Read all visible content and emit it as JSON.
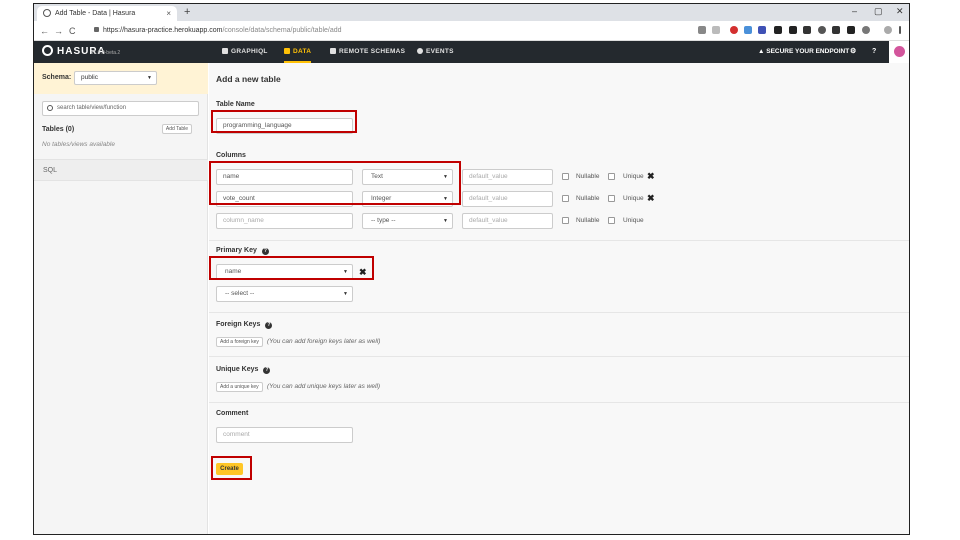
{
  "browser": {
    "tab_title": "Add Table - Data | Hasura",
    "tab_close": "×",
    "new_tab": "+",
    "window_controls": {
      "minimize": "–",
      "maximize": "▢",
      "close": "✕"
    },
    "nav": {
      "back": "←",
      "forward": "→",
      "reload": "C"
    },
    "url_host": "https://hasura-practice.herokuapp.com",
    "url_path": "/console/data/schema/public/table/add"
  },
  "header": {
    "logo": "HASURA",
    "version": "v1.0.0-beta.2",
    "nav": [
      {
        "label": "GRAPHIQL"
      },
      {
        "label": "DATA"
      },
      {
        "label": "REMOTE SCHEMAS"
      },
      {
        "label": "EVENTS"
      }
    ],
    "secure": "▲ SECURE YOUR ENDPOINT",
    "settings_glyph": "⚙",
    "help_glyph": "?",
    "accent_color": "#ffc107",
    "background_color": "#24292e"
  },
  "sidebar": {
    "schema_label": "Schema:",
    "schema_value": "public",
    "search_placeholder": "search table/view/function",
    "tables_label": "Tables (0)",
    "add_table": "Add Table",
    "empty_text": "No tables/views available",
    "sql": "SQL"
  },
  "main": {
    "title": "Add a new table",
    "table_name_label": "Table Name",
    "table_name_value": "programming_language",
    "columns_label": "Columns",
    "columns": [
      {
        "name": "name",
        "type": "Text",
        "default_placeholder": "default_value",
        "nullable": "Nullable",
        "unique": "Unique",
        "remove": "✖"
      },
      {
        "name": "vote_count",
        "type": "Integer",
        "default_placeholder": "default_value",
        "nullable": "Nullable",
        "unique": "Unique",
        "remove": "✖"
      },
      {
        "name_placeholder": "column_name",
        "type": "-- type --",
        "default_placeholder": "default_value",
        "nullable": "Nullable",
        "unique": "Unique"
      }
    ],
    "primary_key_label": "Primary Key",
    "help_glyph": "?",
    "primary_key_value": "name",
    "primary_key_remove": "✖",
    "primary_key_empty": "-- select --",
    "foreign_keys_label": "Foreign Keys",
    "add_foreign_key": "Add a foreign key",
    "foreign_keys_hint": "(You can add foreign keys later as well)",
    "unique_keys_label": "Unique Keys",
    "add_unique_key": "Add a unique key",
    "unique_keys_hint": "(You can add unique keys later as well)",
    "comment_label": "Comment",
    "comment_placeholder": "comment",
    "create_button": "Create"
  },
  "colors": {
    "annotation_red": "#c00000",
    "create_button": "#ffc627",
    "schema_bar": "#fff3d5"
  }
}
